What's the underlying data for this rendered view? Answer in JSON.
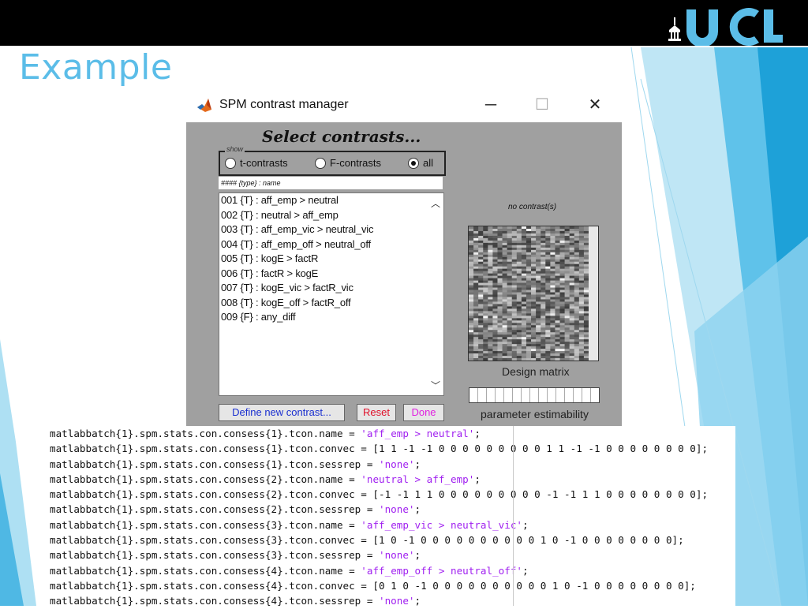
{
  "slide": {
    "title": "Example",
    "logo_text": "UCL",
    "colors": {
      "title": "#5bbde8",
      "accent": "#1ea1d8"
    }
  },
  "window": {
    "title": "SPM contrast manager",
    "icon": "matlab-icon",
    "controls": {
      "minimize": "─",
      "maximize": "☐",
      "close": "✕"
    },
    "heading": "Select contrasts...",
    "show_legend": "show",
    "radios": [
      {
        "label": "t-contrasts",
        "selected": false
      },
      {
        "label": "F-contrasts",
        "selected": false
      },
      {
        "label": "all",
        "selected": true
      }
    ],
    "list_header": "#### {type} : name",
    "contrasts": [
      "001 {T} : aff_emp > neutral",
      "002 {T} : neutral > aff_emp",
      "003 {T} : aff_emp_vic > neutral_vic",
      "004 {T} : aff_emp_off > neutral_off",
      "005 {T} : kogE > factR",
      "006 {T} : factR > kogE",
      "007 {T} : kogE_vic > factR_vic",
      "008 {T} : kogE_off > factR_off",
      "009 {F} : any_diff"
    ],
    "no_contrast_label": "no contrast(s)",
    "design_matrix_label": "Design matrix",
    "parameter_label": "parameter estimability",
    "buttons": {
      "define": "Define new contrast...",
      "reset": "Reset",
      "done": "Done"
    }
  },
  "code_lines": [
    {
      "pre": "matlabbatch{1}.spm.stats.con.consess{1}.tcon.name = ",
      "str": "'aff_emp > neutral'",
      "post": ";"
    },
    {
      "pre": "matlabbatch{1}.spm.stats.con.consess{1}.tcon.convec = [1 1 -1 -1 0 0 0 0 0 0 0 0 0 1 1 -1 -1 0 0 0 0 0 0 0 0];",
      "str": "",
      "post": ""
    },
    {
      "pre": "matlabbatch{1}.spm.stats.con.consess{1}.tcon.sessrep = ",
      "str": "'none'",
      "post": ";"
    },
    {
      "pre": "matlabbatch{1}.spm.stats.con.consess{2}.tcon.name = ",
      "str": "'neutral > aff_emp'",
      "post": ";"
    },
    {
      "pre": "matlabbatch{1}.spm.stats.con.consess{2}.tcon.convec = [-1 -1 1 1 0 0 0 0 0 0 0 0 0 -1 -1 1 1 0 0 0 0 0 0 0 0];",
      "str": "",
      "post": ""
    },
    {
      "pre": "matlabbatch{1}.spm.stats.con.consess{2}.tcon.sessrep = ",
      "str": "'none'",
      "post": ";"
    },
    {
      "pre": "matlabbatch{1}.spm.stats.con.consess{3}.tcon.name = ",
      "str": "'aff_emp_vic > neutral_vic'",
      "post": ";"
    },
    {
      "pre": "matlabbatch{1}.spm.stats.con.consess{3}.tcon.convec = [1 0 -1 0 0 0 0 0 0 0 0 0 0 1 0 -1 0 0 0 0 0 0 0 0];",
      "str": "",
      "post": ""
    },
    {
      "pre": "matlabbatch{1}.spm.stats.con.consess{3}.tcon.sessrep = ",
      "str": "'none'",
      "post": ";"
    },
    {
      "pre": "matlabbatch{1}.spm.stats.con.consess{4}.tcon.name = ",
      "str": "'aff_emp_off > neutral_off'",
      "post": ";"
    },
    {
      "pre": "matlabbatch{1}.spm.stats.con.consess{4}.tcon.convec = [0 1 0 -1 0 0 0 0 0 0 0 0 0 0 1 0 -1 0 0 0 0 0 0 0 0];",
      "str": "",
      "post": ""
    },
    {
      "pre": "matlabbatch{1}.spm.stats.con.consess{4}.tcon.sessrep = ",
      "str": "'none'",
      "post": ";"
    }
  ]
}
